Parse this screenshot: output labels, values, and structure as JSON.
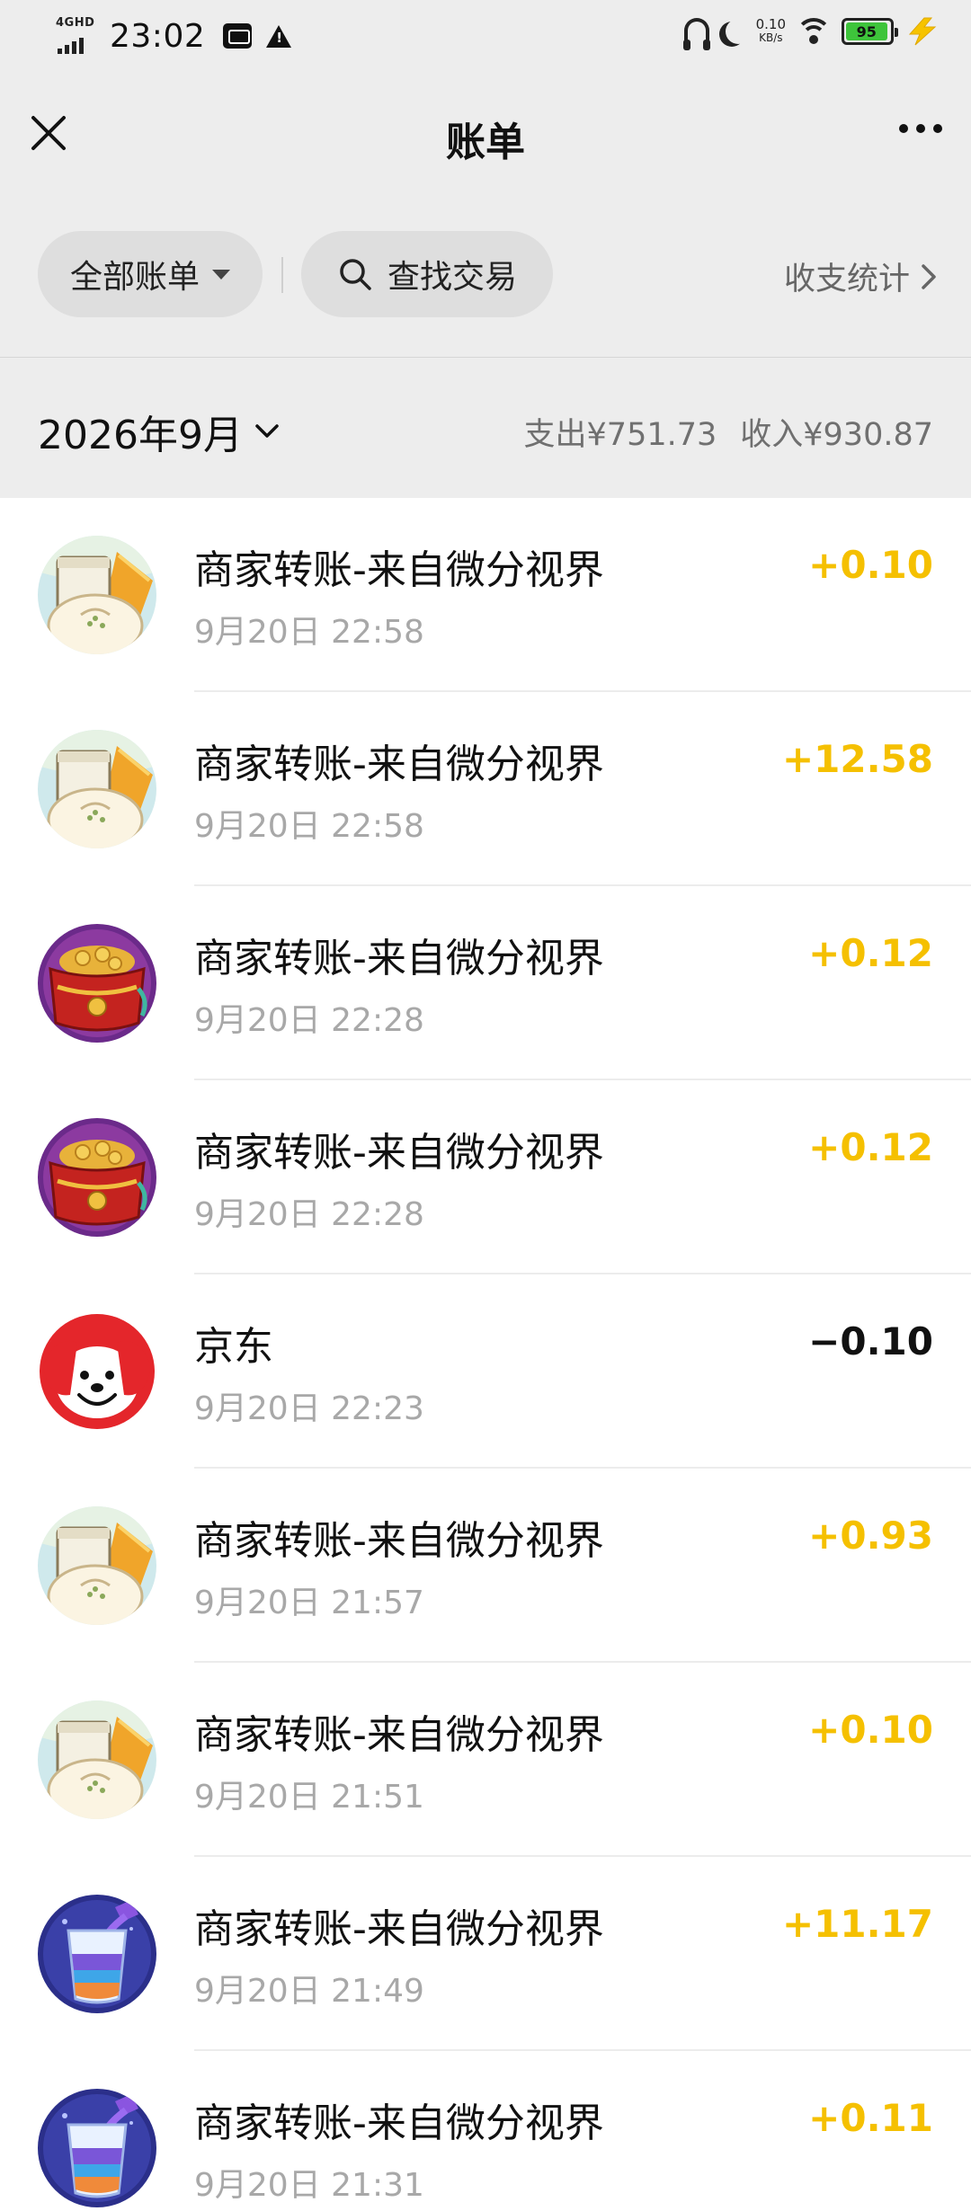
{
  "status_bar": {
    "network": "4GHD",
    "time": "23:02",
    "speed_value": "0.10",
    "speed_unit": "KB/s",
    "battery": "95",
    "battery_level": 0.95,
    "battery_color": "#3ec43b"
  },
  "nav": {
    "title": "账单",
    "close_icon": "close-icon",
    "more_icon": "more-icon"
  },
  "filter": {
    "all_label": "全部账单",
    "search_label": "查找交易",
    "stats_label": "收支统计"
  },
  "month": {
    "label": "2026年9月",
    "expense": "支出¥751.73",
    "income": "收入¥930.87"
  },
  "colors": {
    "income": "#f5c000",
    "expense": "#111111",
    "background": "#ededed"
  },
  "transactions": [
    {
      "title": "商家转账-来自微分视界",
      "time": "9月20日 22:58",
      "amount": "+0.10",
      "type": "income",
      "avatar": "bun-avatar"
    },
    {
      "title": "商家转账-来自微分视界",
      "time": "9月20日 22:58",
      "amount": "+12.58",
      "type": "income",
      "avatar": "bun-avatar"
    },
    {
      "title": "商家转账-来自微分视界",
      "time": "9月20日 22:28",
      "amount": "+0.12",
      "type": "income",
      "avatar": "treasure-avatar"
    },
    {
      "title": "商家转账-来自微分视界",
      "time": "9月20日 22:28",
      "amount": "+0.12",
      "type": "income",
      "avatar": "treasure-avatar"
    },
    {
      "title": "京东",
      "time": "9月20日 22:23",
      "amount": "−0.10",
      "type": "expense",
      "avatar": "jd-dog-avatar"
    },
    {
      "title": "商家转账-来自微分视界",
      "time": "9月20日 21:57",
      "amount": "+0.93",
      "type": "income",
      "avatar": "bun-avatar"
    },
    {
      "title": "商家转账-来自微分视界",
      "time": "9月20日 21:51",
      "amount": "+0.10",
      "type": "income",
      "avatar": "bun-avatar"
    },
    {
      "title": "商家转账-来自微分视界",
      "time": "9月20日 21:49",
      "amount": "+11.17",
      "type": "income",
      "avatar": "drink-avatar"
    },
    {
      "title": "商家转账-来自微分视界",
      "time": "9月20日 21:31",
      "amount": "+0.11",
      "type": "income",
      "avatar": "drink-avatar"
    }
  ]
}
